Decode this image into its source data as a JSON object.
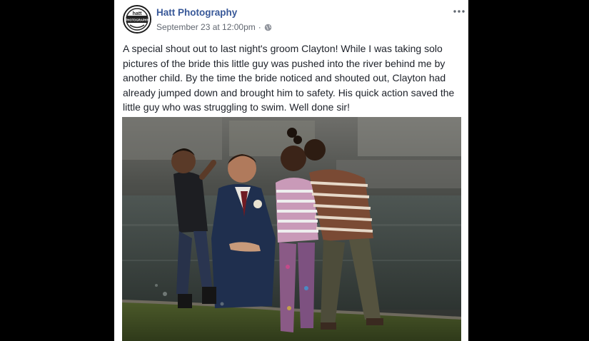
{
  "post": {
    "page_name": "Hatt Photography",
    "timestamp": "September 23 at 12:00pm",
    "separator": "·",
    "privacy_icon": "globe-icon",
    "more_icon": "more-options-icon",
    "text": "A special shout out to last night's groom Clayton! While I was taking solo pictures of the bride this little guy was pushed into the river behind me by another child. By the time the bride noticed and shouted out, Clayton had already jumped down and brought him to safety. His quick action saved the little guy who was struggling to swim. Well done sir!"
  },
  "avatar": {
    "logo_text": "hatt",
    "logo_subtext": "PHOTOGRAPHY"
  },
  "colors": {
    "link": "#385898",
    "meta": "#616770",
    "body_text": "#1d2129",
    "background": "#000000"
  }
}
